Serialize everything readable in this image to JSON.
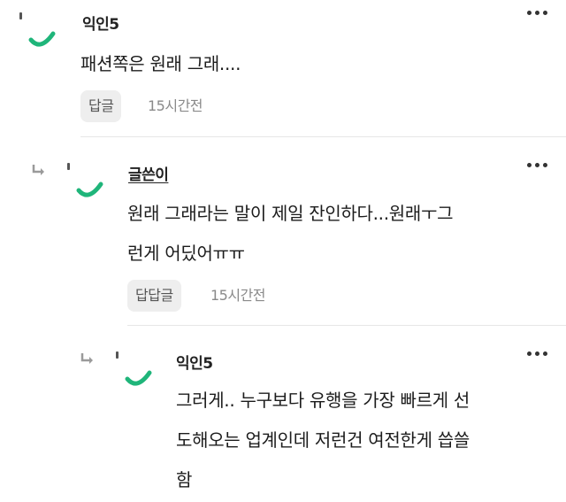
{
  "comments": [
    {
      "author": "익인5",
      "text_lines": [
        "패션쪽은 원래 그래...."
      ],
      "reply_label": "답글",
      "time": "15시간전"
    },
    {
      "author": "글쓴이",
      "text_lines": [
        "원래 그래라는 말이 제일 잔인하다...원래ㅜ그",
        "런게 어딨어ㅠㅠ"
      ],
      "reply_label": "답답글",
      "time": "15시간전"
    },
    {
      "author": "익인5",
      "text_lines": [
        "그러게.. 누구보다 유행을 가장 빠르게 선",
        "도해오는 업계인데 저런건 여전한게 씁쓸",
        "함"
      ]
    }
  ],
  "colors": {
    "avatar_accent": "#1fb57a",
    "badge_bg": "#eeeeee",
    "time": "#8a8a8a"
  },
  "icons": {
    "more": "more-vertical-icon",
    "reply": "reply-arrow-icon"
  }
}
